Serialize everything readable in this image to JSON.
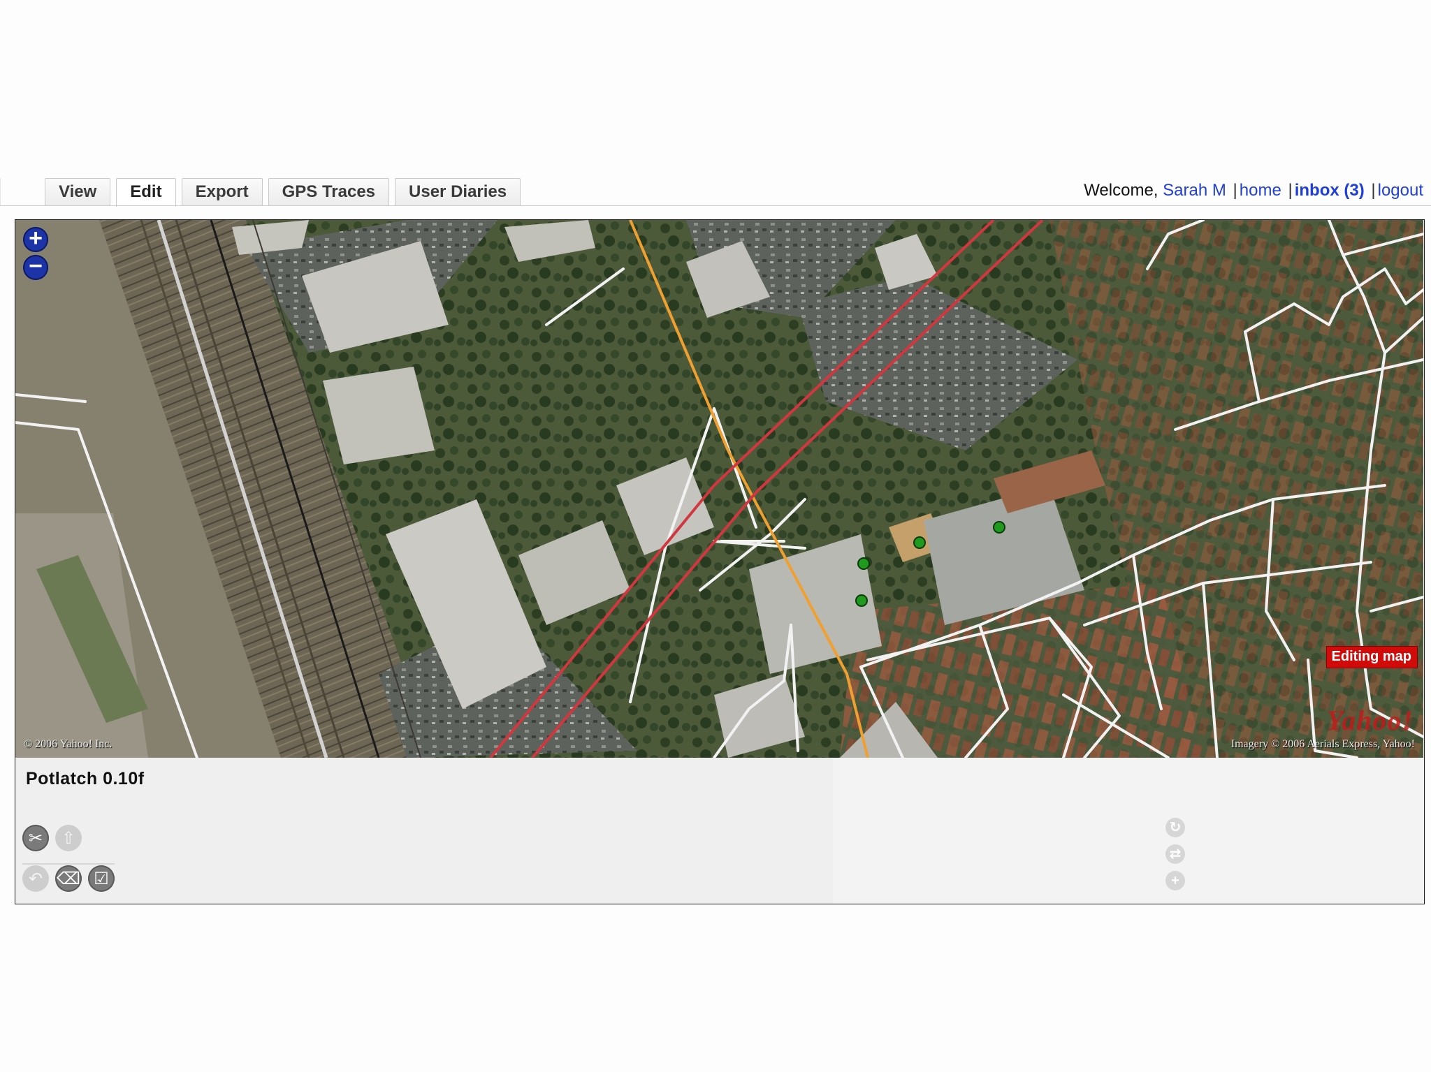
{
  "tabs": [
    {
      "label": "View",
      "active": false
    },
    {
      "label": "Edit",
      "active": true
    },
    {
      "label": "Export",
      "active": false
    },
    {
      "label": "GPS Traces",
      "active": false
    },
    {
      "label": "User Diaries",
      "active": false
    }
  ],
  "account": {
    "welcome": "Welcome,",
    "user": "Sarah M",
    "home": "home",
    "inbox": "inbox (3)",
    "logout": "logout",
    "separator": "|"
  },
  "map": {
    "zoom_in": "+",
    "zoom_out": "−",
    "copyright_left": "© 2006 Yahoo! Inc.",
    "copyright_right": "Imagery © 2006 Aerials Express, Yahoo!",
    "provider_logo": "Yahoo!",
    "badge": "Editing map",
    "colors": {
      "motorway": "#d2373f",
      "primary_road": "#f0a030",
      "street": "#f2f2f2",
      "poi_node": "#1f9a1f"
    }
  },
  "editor": {
    "title": "Potlatch 0.10f",
    "tools_row1": [
      {
        "icon": "scissors-icon",
        "glyph": "✂",
        "enabled": true
      },
      {
        "icon": "up-arrow-icon",
        "glyph": "⇧",
        "enabled": false
      }
    ],
    "tools_row2": [
      {
        "icon": "undo-icon",
        "glyph": "↶",
        "enabled": false
      },
      {
        "icon": "eraser-icon",
        "glyph": "⌫",
        "enabled": true
      },
      {
        "icon": "checkbox-icon",
        "glyph": "☑",
        "enabled": true
      }
    ],
    "side_buttons": [
      {
        "icon": "rotate-icon",
        "glyph": "↻"
      },
      {
        "icon": "swap-icon",
        "glyph": "⇄"
      },
      {
        "icon": "plus-icon",
        "glyph": "+"
      }
    ]
  }
}
